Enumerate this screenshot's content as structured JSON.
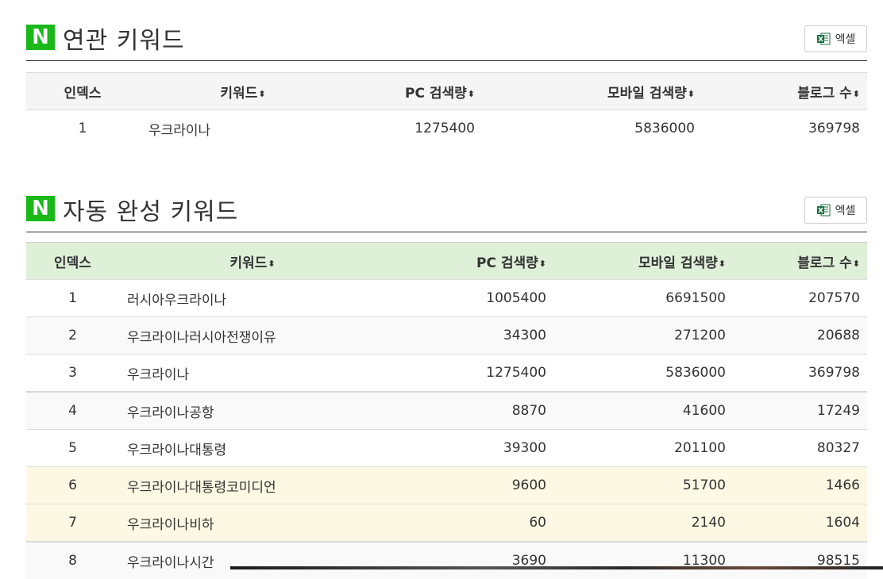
{
  "related": {
    "logo": "N",
    "title": "연관 키워드",
    "excel_label": "엑셀",
    "headers": [
      "인덱스",
      "키워드",
      "PC 검색량",
      "모바일 검색량",
      "블로그 수"
    ],
    "sort_glyph": "⬍",
    "rows": [
      {
        "index": "1",
        "keyword": "우크라이나",
        "pc": "1275400",
        "mobile": "5836000",
        "blog": "369798"
      }
    ]
  },
  "autocomplete": {
    "logo": "N",
    "title": "자동 완성 키워드",
    "excel_label": "엑셀",
    "headers": [
      "인덱스",
      "키워드",
      "PC 검색량",
      "모바일 검색량",
      "블로그 수"
    ],
    "sort_glyph": "⬍",
    "rows": [
      {
        "index": "1",
        "keyword": "러시아우크라이나",
        "pc": "1005400",
        "mobile": "6691500",
        "blog": "207570"
      },
      {
        "index": "2",
        "keyword": "우크라이나러시아전쟁이유",
        "pc": "34300",
        "mobile": "271200",
        "blog": "20688"
      },
      {
        "index": "3",
        "keyword": "우크라이나",
        "pc": "1275400",
        "mobile": "5836000",
        "blog": "369798"
      },
      {
        "index": "4",
        "keyword": "우크라이나공항",
        "pc": "8870",
        "mobile": "41600",
        "blog": "17249"
      },
      {
        "index": "5",
        "keyword": "우크라이나대통령",
        "pc": "39300",
        "mobile": "201100",
        "blog": "80327"
      },
      {
        "index": "6",
        "keyword": "우크라이나대통령코미디언",
        "pc": "9600",
        "mobile": "51700",
        "blog": "1466"
      },
      {
        "index": "7",
        "keyword": "우크라이나비하",
        "pc": "60",
        "mobile": "2140",
        "blog": "1604"
      },
      {
        "index": "8",
        "keyword": "우크라이나시간",
        "pc": "3690",
        "mobile": "11300",
        "blog": "98515"
      }
    ]
  },
  "colors": {
    "naver_green": "#19b919",
    "header_green": "#dff0d8",
    "warning_row": "#fcf8e3",
    "excel_green": "#1d6f42"
  }
}
